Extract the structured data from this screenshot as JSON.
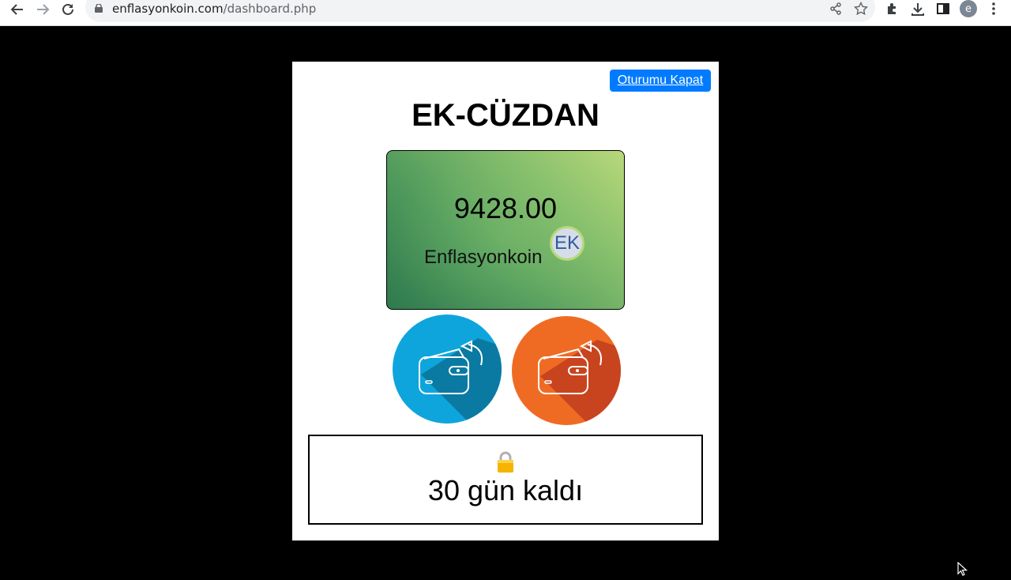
{
  "browser": {
    "url_domain": "enflasyonkoin.com",
    "url_path": "/dashboard.php",
    "profile_initial": "e"
  },
  "header": {
    "logout_label": "Oturumu Kapat",
    "title": "EK-CÜZDAN"
  },
  "wallet": {
    "balance": "9428.00",
    "coin_name": "Enflasyonkoin",
    "coin_badge": "EK"
  },
  "actions": {
    "send_icon": "wallet-send-icon",
    "receive_icon": "wallet-receive-icon"
  },
  "lock": {
    "icon": "lock-icon",
    "days_left": "30 gün kaldı"
  },
  "colors": {
    "logout_bg": "#007bff",
    "send_bg": "#0ea5dc",
    "receive_bg": "#ef6b24",
    "card_dark": "#2f7a4e",
    "card_light": "#b9d87a"
  }
}
